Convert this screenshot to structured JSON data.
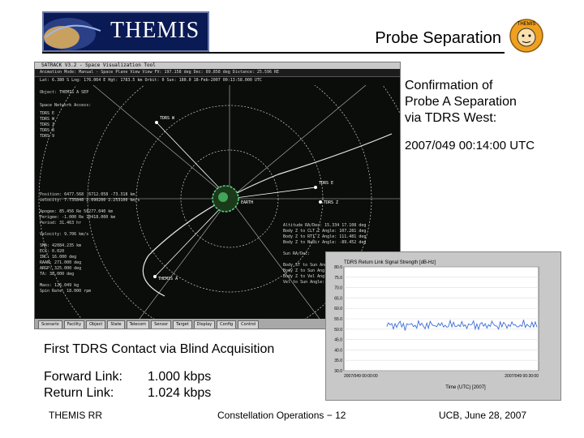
{
  "header": {
    "logo_text": "THEMIS",
    "slide_title": "Probe Separation",
    "mascot_text": "THEMIS"
  },
  "confirmation": {
    "lines": [
      "Confirmation of",
      "Probe A Separation",
      "via TDRS West:"
    ],
    "timestamp": "2007/049  00:14:00 UTC"
  },
  "sim": {
    "window_title": "SATRACK V3.2 - Space Visualization Tool",
    "menu_line1": "Animation Mode: Manual - Space Plane View          View FV: 197.158 deg   Dec: 89.858 deg   Distance: 25.596 RE",
    "menu_line2": "Lat: 6.380 S  Lng: 176.064 E  Hgt: 1783.5 km  Orbit: 0  Sun: 180.0   18-Feb-2007 00:13:58.000 UTC",
    "object": "Object: THEMIS A SEP",
    "network_label": "Space Network Access:",
    "access_rows": [
      "TDRS E",
      "TDRS W",
      "TDRS Z",
      "TDRS 8",
      "TDRS 9"
    ],
    "state_left": [
      "Position:   6477.568  -6712.058   -73.318 km",
      "Velocity:   7.735848   2.090200   2.253100 km/s",
      "",
      "Apogee:     85.456 Re   58277.040 km",
      "Perigee:    -1.000 Re   10418.000 km",
      "Period:     31.463 hr",
      "",
      "Velocity:   9.706 km/s",
      "",
      "SMA:        42084.235 km",
      "ECC:        0.020",
      "INC:        16.000 deg",
      "RAAN:       271.000 deg",
      "ARGP:       325.000 deg",
      "TA:         38.000 deg",
      "",
      "Mass:       126.049 kg",
      "Spin Rate:  18.000 rpm"
    ],
    "state_right": [
      "Altitude RA/Dec:   15.334   17.108 deg",
      "Body Z to CLT Z Angle: 107.281 deg",
      "Body Z to RTI Z Angle: 111.481 deg",
      "Body Z to Nadir Angle: -89.452 deg",
      "",
      "Sun RA/Dec:",
      "",
      "Body ST to Sun Angle:",
      "Body Z to Sun Angle:",
      "Body Z to Vel Angle:",
      "Vel to Sun Angle:"
    ],
    "orbit_labels": [
      "TDRS W",
      "TDRS E",
      "TDRS Z",
      "THEMIS A",
      "EARTH"
    ],
    "buttons": [
      "Scenario",
      "Facility",
      "Object",
      "State",
      "Telecom",
      "Sensor",
      "Target",
      "Display",
      "Config",
      "Control"
    ]
  },
  "plot": {
    "title": "TDRS Return Link Signal Strength [dB-Hz]",
    "y_ticks": [
      "80.0",
      "75.0",
      "70.0",
      "65.0",
      "60.0",
      "55.0",
      "50.0",
      "45.0",
      "40.0",
      "35.0",
      "30.0"
    ],
    "x_start_label": "2007/049 00:00:00",
    "x_end_label": "2007/049 00:30:00",
    "xlabel": "Time (UTC) [2007]",
    "signal_level": 52
  },
  "blind": {
    "heading": "First TDRS Contact via Blind Acquisition",
    "forward_label": "Forward Link:",
    "forward_value": "1.000 kbps",
    "return_label": "Return Link:",
    "return_value": "1.024 kbps"
  },
  "footer": {
    "left": "THEMIS RR",
    "center": "Constellation Operations − 12",
    "right": "UCB, June 28, 2007"
  },
  "colors": {
    "logo_bg": "#0a1a55",
    "sim_bg": "#0b0d0b",
    "orbit_line": "#d6d6d6",
    "plot_line": "#3a6ed8"
  }
}
